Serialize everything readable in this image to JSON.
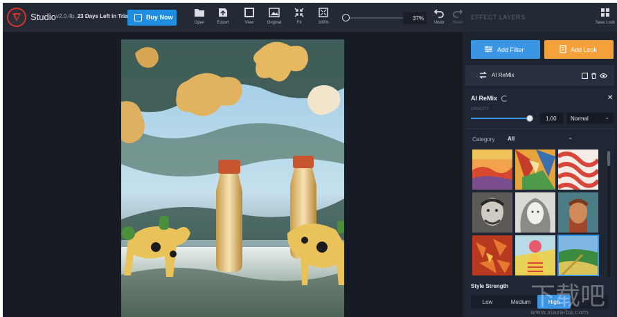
{
  "app": {
    "name": "Studio",
    "version": "v2.0.4b,",
    "trial": "23 Days Left in Trial",
    "buy_label": "Buy Now"
  },
  "toolbar": {
    "open": "Open",
    "export": "Export",
    "view": "View",
    "original": "Original",
    "fit": "Fit",
    "zoom100": "100%",
    "zoom_value": "37%",
    "undo": "Undo",
    "redo": "Redo",
    "effect_layers": "EFFECT LAYERS",
    "save_look": "Save Look"
  },
  "panel": {
    "add_filter": "Add Filter",
    "add_look": "Add Look",
    "layer_name": "AI ReMix",
    "section_title": "AI ReMix",
    "opacity_label": "OPACITY",
    "opacity_value": "1.00",
    "opacity_fraction": 1.0,
    "blend_mode": "Normal",
    "category_label": "Category",
    "category_value": "All",
    "style_strength_label": "Style Strength",
    "strength_options": [
      "Low",
      "Medium",
      "High"
    ],
    "strength_selected": "High"
  },
  "thumbnails": [
    {
      "name": "sunset-hills"
    },
    {
      "name": "mosaic-abstract"
    },
    {
      "name": "red-curves"
    },
    {
      "name": "sketch-man"
    },
    {
      "name": "sketch-woman"
    },
    {
      "name": "painted-portrait"
    },
    {
      "name": "autumn-leaves"
    },
    {
      "name": "pop-art-figure"
    },
    {
      "name": "landscape-meadow"
    }
  ],
  "colors": {
    "accent_blue": "#3b95e5",
    "accent_orange": "#f4a13b",
    "buy_blue": "#1e8ee0",
    "brand_red": "#d8342c"
  }
}
